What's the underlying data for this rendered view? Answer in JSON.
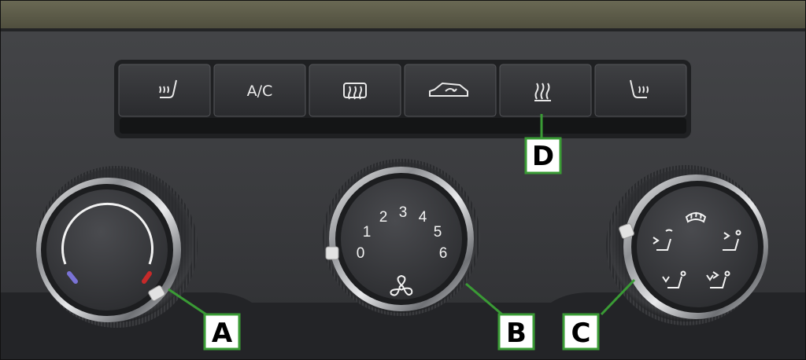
{
  "buttons": [
    {
      "id": "left-seat-heat",
      "label": "",
      "icon": "seat-heating-icon"
    },
    {
      "id": "ac",
      "label": "A/C",
      "icon": ""
    },
    {
      "id": "rear-window-heat",
      "label": "",
      "icon": "rear-window-heating-icon"
    },
    {
      "id": "recirculation",
      "label": "",
      "icon": "air-recirculation-icon"
    },
    {
      "id": "heating",
      "label": "",
      "icon": "heating-icon"
    },
    {
      "id": "right-seat-heat",
      "label": "",
      "icon": "seat-heating-icon"
    }
  ],
  "fan_dial": {
    "numbers": [
      "0",
      "1",
      "2",
      "3",
      "4",
      "5",
      "6"
    ],
    "icon": "fan-icon"
  },
  "air_distribution_dial": {
    "icons": [
      "windscreen-defrost-icon",
      "air-to-windscreen-and-body-icon",
      "air-to-head-icon",
      "air-to-feet-icon",
      "air-to-feet-and-body-icon"
    ]
  },
  "callouts": {
    "a": "A",
    "b": "B",
    "c": "C",
    "d": "D"
  },
  "colors": {
    "callout_green": "#3a9b35",
    "cold_indicator": "#7a73d6",
    "hot_indicator": "#c62a2a",
    "panel": "#3c3d40",
    "trim": "#5b5a46"
  }
}
